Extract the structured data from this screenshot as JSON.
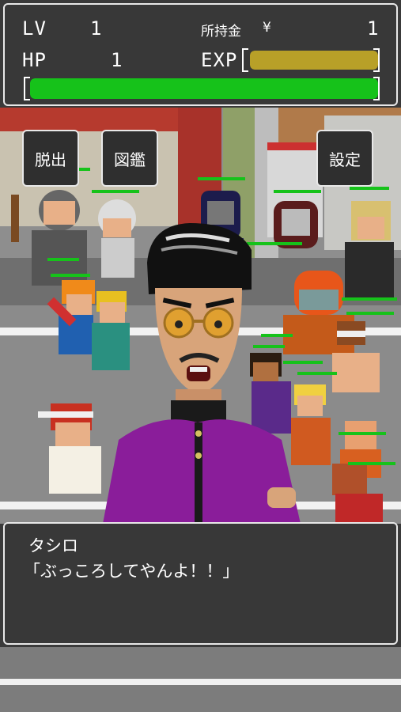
{
  "status": {
    "lv_label": "LV",
    "lv_value": "1",
    "money_label": "所持金",
    "money_symbol": "¥",
    "money_value": "1",
    "hp_label": "HP",
    "hp_value": "1",
    "exp_label": "EXP",
    "exp_fill_fraction": 1.0,
    "hp_fill_fraction": 1.0
  },
  "buttons": {
    "escape": "脱出",
    "encyclopedia": "図鑑",
    "settings": "設定"
  },
  "dialog": {
    "speaker": "タシロ",
    "line": "「ぶっころしてやんよ！！」"
  },
  "colors": {
    "hp_bar": "#16c21a",
    "exp_bar": "#b8a028",
    "panel_bg": "#383838",
    "panel_border": "#e8e8e8",
    "boss_uniform": "#8a1d9a"
  }
}
